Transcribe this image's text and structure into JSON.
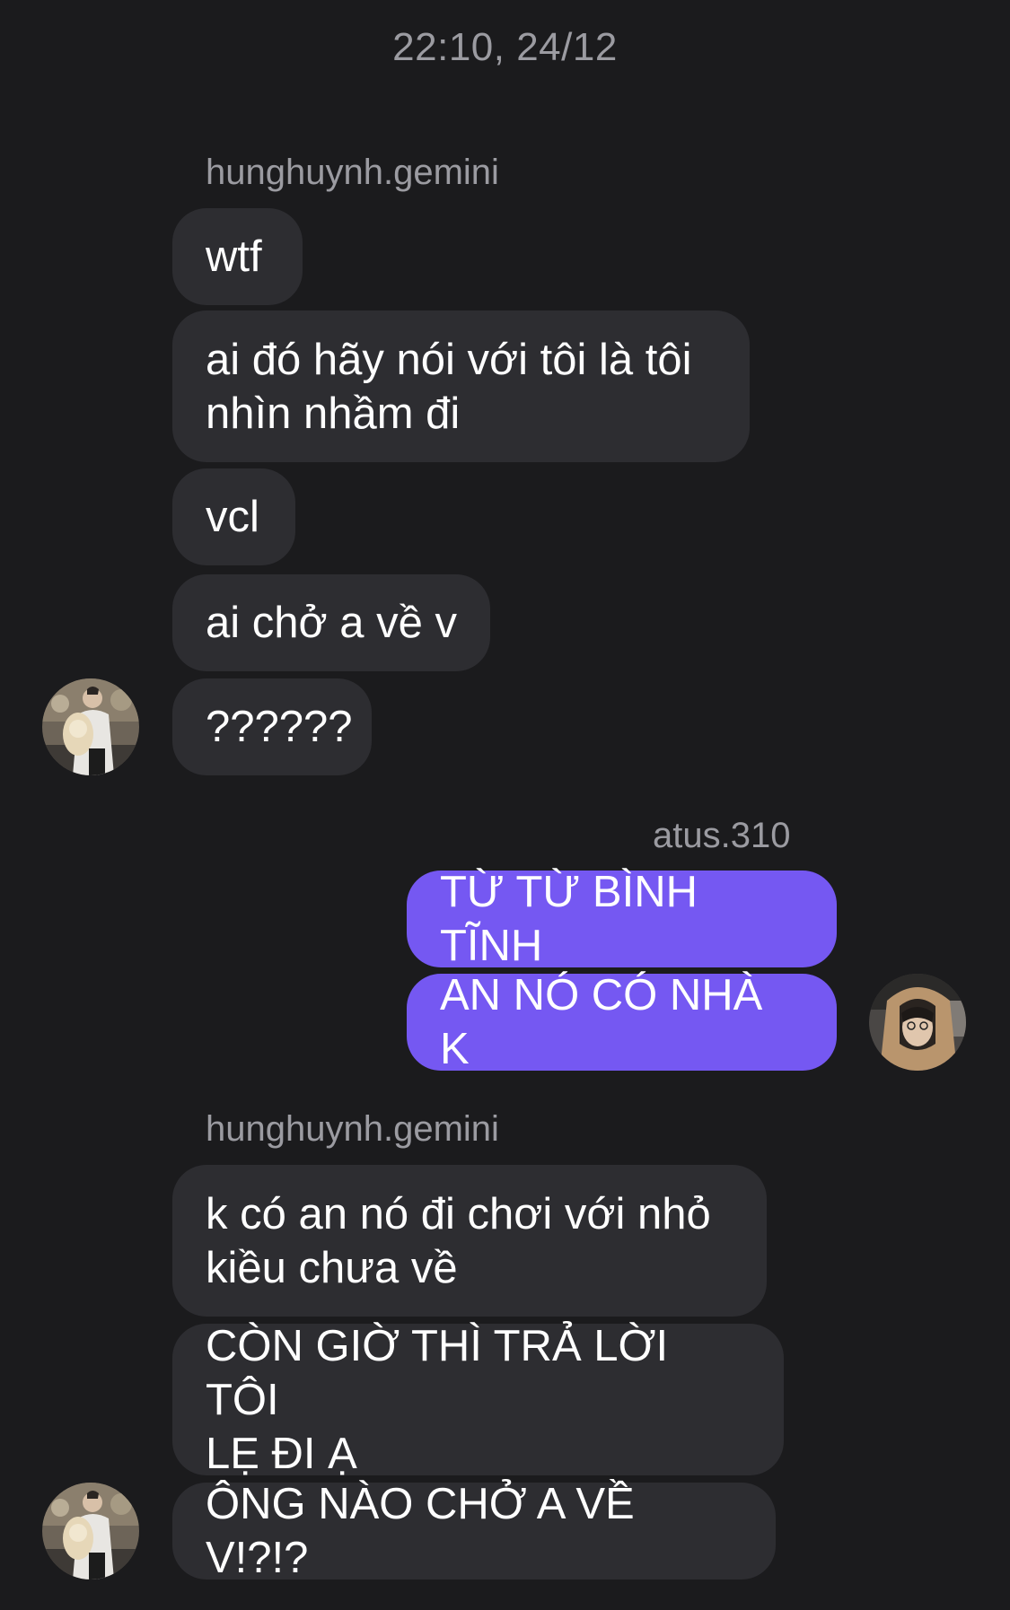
{
  "timestamp": "22:10, 24/12",
  "groups": [
    {
      "sender": "hunghuynh.gemini",
      "direction": "incoming",
      "messages": [
        "wtf",
        "ai đó hãy nói với tôi là tôi\nnhìn nhầm đi",
        "vcl",
        "ai chở a về v",
        "??????"
      ],
      "avatar_icon": "person-with-bouquet-photo"
    },
    {
      "sender": "atus.310",
      "direction": "outgoing",
      "messages": [
        "TỪ TỪ BÌNH TĨNH",
        "AN NÓ CÓ NHÀ K"
      ],
      "avatar_icon": "person-in-hoodie-photo"
    },
    {
      "sender": "hunghuynh.gemini",
      "direction": "incoming",
      "messages": [
        "k có an nó đi chơi với nhỏ\nkiều chưa về",
        "CÒN GIỜ THÌ TRẢ LỜI TÔI\nLẸ ĐI Ạ",
        "ÔNG NÀO CHỞ A VỀ V!?!?"
      ],
      "avatar_icon": "person-with-bouquet-photo"
    }
  ],
  "colors": {
    "background": "#1b1b1d",
    "incoming_bubble": "#2d2d31",
    "outgoing_bubble": "#7558f2",
    "meta_text": "#9b9ba1"
  }
}
